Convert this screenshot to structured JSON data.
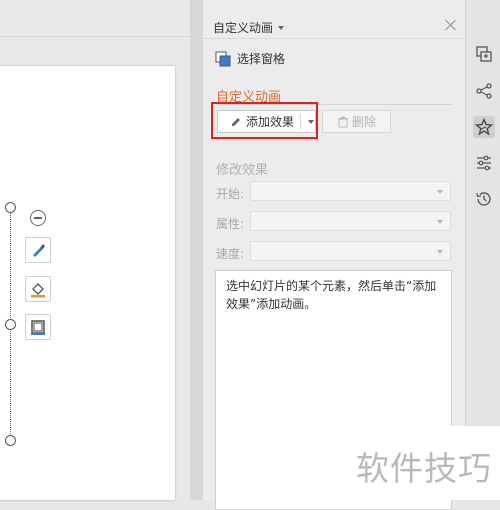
{
  "task_pane": {
    "title": "自定义动画",
    "selection_pane_label": "选择窗格",
    "section_title": "自定义动画",
    "add_effect_label": "添加效果",
    "delete_label": "删除",
    "modify_title": "修改效果",
    "rows": [
      {
        "label": "开始:",
        "value": ""
      },
      {
        "label": "属性:",
        "value": ""
      },
      {
        "label": "速度:",
        "value": ""
      }
    ],
    "hint_text": "选中幻灯片的某个元素，然后单击“添加效果”添加动画。"
  },
  "sidebar_icons": [
    "slides-icon",
    "share-icon",
    "animation-star-icon",
    "settings-sliders-icon",
    "history-icon"
  ],
  "watermark": "软件技巧",
  "colors": {
    "accent": "#d86a2b",
    "highlight_box": "#d9231f"
  }
}
